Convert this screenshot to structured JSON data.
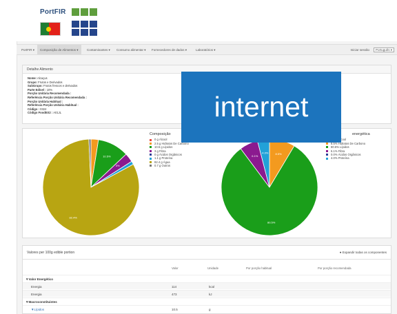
{
  "header": {
    "logo_text": "PortFIR"
  },
  "nav": {
    "items": [
      "PortFIR ▾",
      "Composição de Alimentos ▾",
      "Contaminantes ▾",
      "Consumo alimentar ▾",
      "Fornecedores de dados ▾",
      "Laboratórios ▾"
    ],
    "login": "Iniciar sessão",
    "language": "Português ▾"
  },
  "detail": {
    "heading": "Detalhe Alimento",
    "lines": [
      {
        "label": "Nome:",
        "value": "Alcaçus"
      },
      {
        "label": "Grupo:",
        "value": "Frutos e Derivados"
      },
      {
        "label": "SubGrupo:",
        "value": "Frutos frescos e derivados"
      },
      {
        "label": "Parte Edível :",
        "value": "10%"
      },
      {
        "label": "Porção Unitária Recomendada :",
        "value": ""
      },
      {
        "label": "Referência Porção Unitária Recomendada :",
        "value": ""
      },
      {
        "label": "Porção Unitária Habitual :",
        "value": ""
      },
      {
        "label": "Referência Porção Unitária Habitual :",
        "value": ""
      },
      {
        "label": "Código :",
        "value": "0324"
      },
      {
        "label": "Código FoodEX2 :",
        "value": "A01JL"
      }
    ]
  },
  "composition": {
    "title": "Composição",
    "items": [
      {
        "text": "0   g  Álcool",
        "color": "#e8453c"
      },
      {
        "text": "2.5 g  Hidratos De Carbono",
        "color": "#f39a1f"
      },
      {
        "text": "10.5 g  Lípidos",
        "color": "#1a9e1a"
      },
      {
        "text": "3   g  Fibra",
        "color": "#8b1a8f"
      },
      {
        "text": "0   g  Ácidos Orgânicos",
        "color": "#2a3b96"
      },
      {
        "text": "1.1 g  Proteína",
        "color": "#22a1d8"
      },
      {
        "text": "82.4 g  Água",
        "color": "#b8a512"
      },
      {
        "text": "0.7 g  Outros",
        "color": "#777777"
      }
    ],
    "slice_labels": [
      "10.5%",
      "3%",
      "82.4%"
    ]
  },
  "energy": {
    "title": "energética",
    "items": [
      {
        "text": "0.0%  Álcool",
        "color": "#e8453c"
      },
      {
        "text": "8.5%  Hidratos De Carbono",
        "color": "#f39a1f"
      },
      {
        "text": "80.5%  Lípidos",
        "color": "#1a9e1a"
      },
      {
        "text": "6.1%  Fibra",
        "color": "#8b1a8f"
      },
      {
        "text": "0.0%  Ácidos Orgânicos",
        "color": "#2a3b96"
      },
      {
        "text": "4.0%  Proteína",
        "color": "#22a1d8"
      }
    ],
    "slice_labels": [
      "8.5%",
      "6.1%",
      "4.0%",
      "80.5%"
    ]
  },
  "values_table": {
    "heading": "Valores per 100g edible portion",
    "expand": "Expandir todas os componentes",
    "columns": [
      "Valor",
      "Unidade",
      "Por porção habitual",
      "Por porção recomendada"
    ],
    "rows": [
      {
        "name": "▼Valor Energético",
        "value": "",
        "unit": "",
        "type": "section"
      },
      {
        "name": "Energia",
        "value": "114",
        "unit": "kcal",
        "type": "row"
      },
      {
        "name": "Energia",
        "value": "473",
        "unit": "kJ",
        "type": "row"
      },
      {
        "name": "▼Macroconstituintes",
        "value": "",
        "unit": "",
        "type": "section"
      },
      {
        "name": "▼Lípidos",
        "value": "10.5",
        "unit": "g",
        "type": "link"
      }
    ]
  },
  "overlay": {
    "text": "internet"
  }
}
